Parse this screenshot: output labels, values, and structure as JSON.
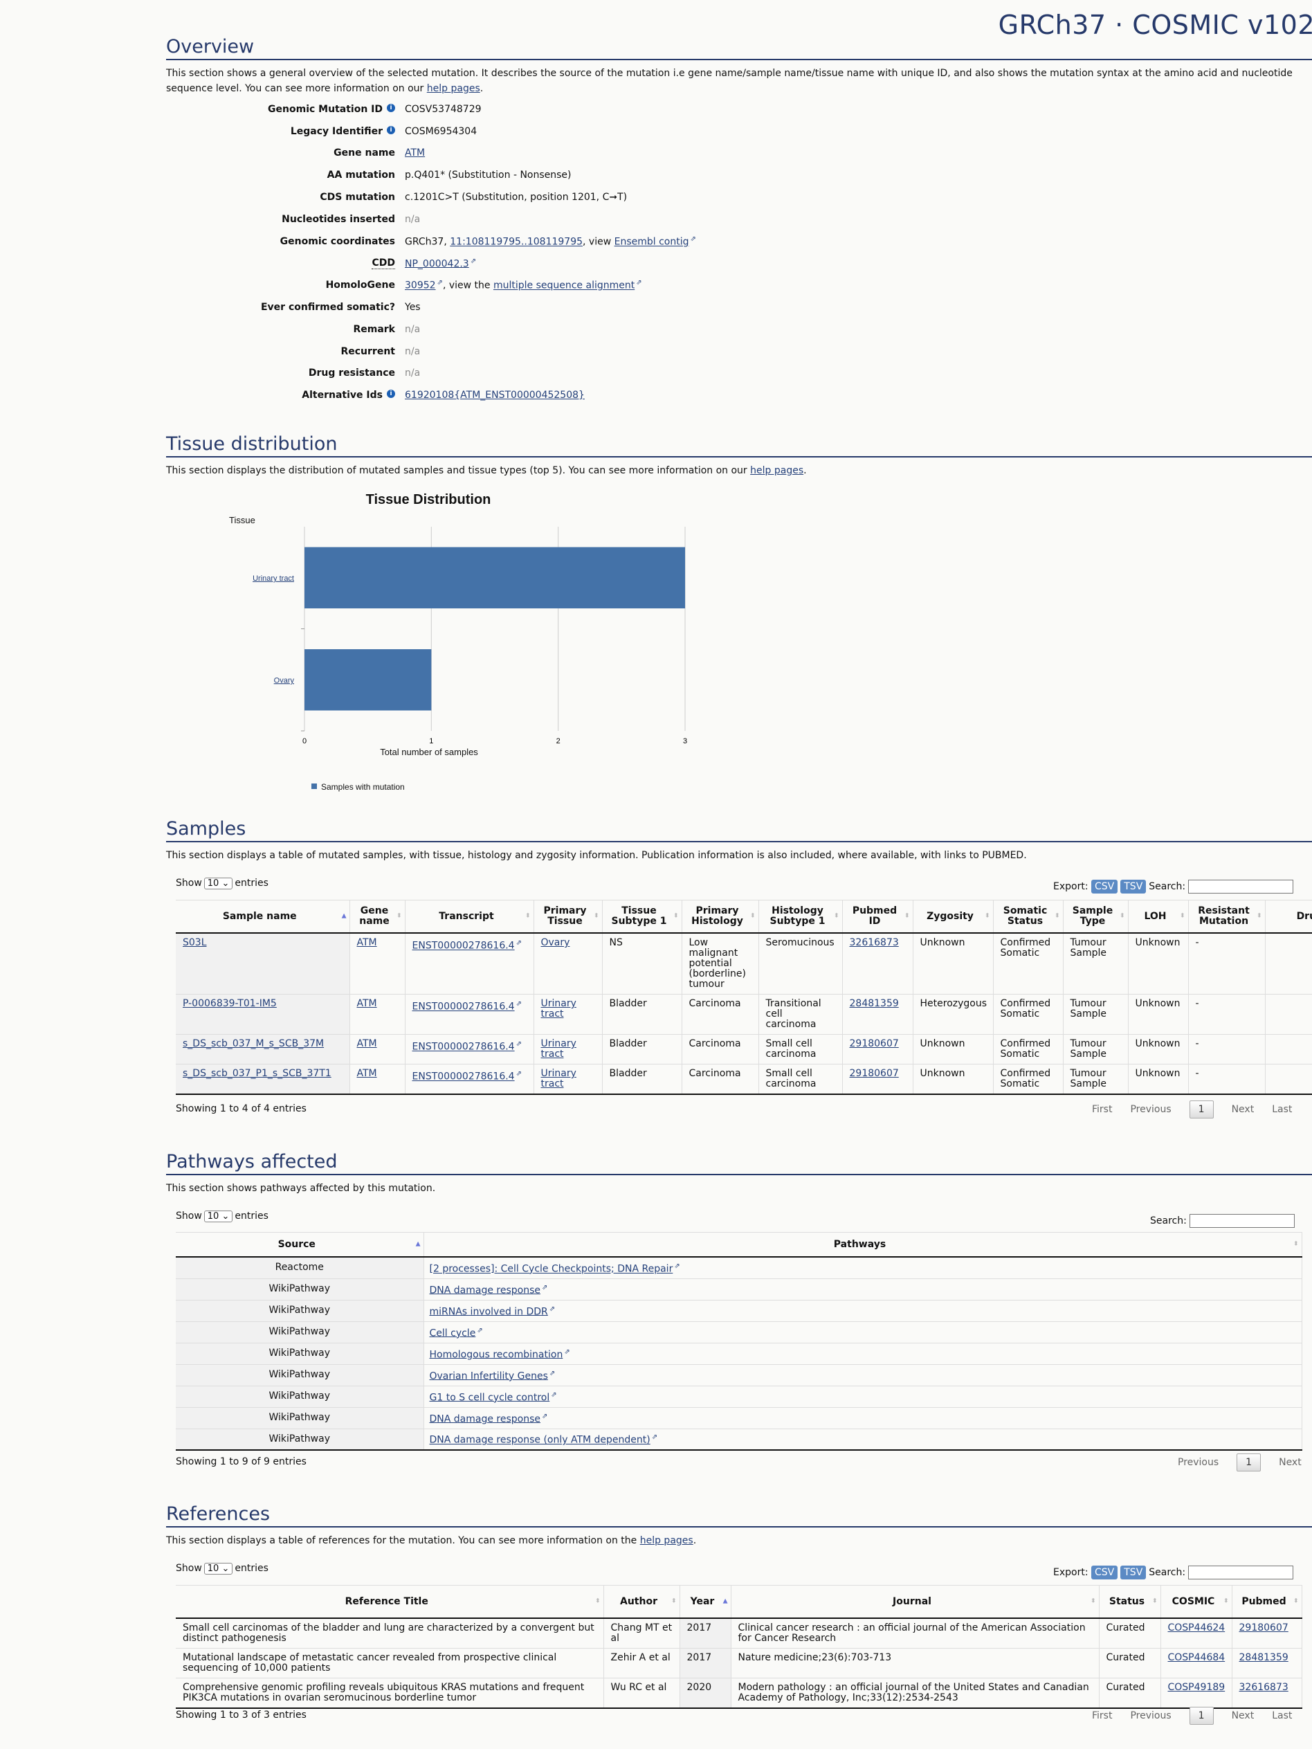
{
  "site_title": "GRCh37 · COSMIC v102",
  "overview": {
    "heading": "Overview",
    "desc_pre": "This section shows a general overview of the selected mutation. It describes the source of the mutation i.e gene name/sample name/tissue name with unique ID, and also shows the mutation syntax at the amino acid and nucleotide sequence level. You can see more information on our ",
    "desc_link": "help pages",
    "desc_post": ".",
    "rows": {
      "gmid": {
        "label": "Genomic Mutation ID",
        "value": "COSV53748729"
      },
      "legacy": {
        "label": "Legacy Identifier",
        "value": "COSM6954304"
      },
      "gene": {
        "label": "Gene name",
        "value": "ATM"
      },
      "aa": {
        "label": "AA mutation",
        "value": "p.Q401* (Substitution - Nonsense)"
      },
      "cds": {
        "label": "CDS mutation",
        "value": "c.1201C>T (Substitution, position 1201, C➞T)"
      },
      "nuc": {
        "label": "Nucleotides inserted",
        "value": "n/a"
      },
      "coords": {
        "label": "Genomic coordinates",
        "pre": "GRCh37, ",
        "link": "11:108119795..108119795",
        "mid": ", view ",
        "link2": "Ensembl contig"
      },
      "cdd": {
        "label": "CDD",
        "link": "NP_000042.3"
      },
      "homolo": {
        "label": "HomoloGene",
        "link": "30952",
        "mid": ", view the ",
        "link2": "multiple sequence alignment"
      },
      "somatic": {
        "label": "Ever confirmed somatic?",
        "value": "Yes"
      },
      "remark": {
        "label": "Remark",
        "value": "n/a"
      },
      "recurrent": {
        "label": "Recurrent",
        "value": "n/a"
      },
      "drug": {
        "label": "Drug resistance",
        "value": "n/a"
      },
      "alt": {
        "label": "Alternative Ids",
        "link": "61920108{ATM_ENST00000452508}"
      }
    }
  },
  "tissue": {
    "heading": "Tissue distribution",
    "desc_pre": "This section displays the distribution of mutated samples and tissue types (top 5). You can see more information on our ",
    "desc_link": "help pages",
    "desc_post": "."
  },
  "chart_data": {
    "type": "bar",
    "orientation": "horizontal",
    "title": "Tissue Distribution",
    "ylabel": "Tissue",
    "xlabel": "Total number of samples",
    "categories": [
      "Urinary tract",
      "Ovary"
    ],
    "series": [
      {
        "name": "Samples with mutation",
        "values": [
          3,
          1
        ]
      }
    ],
    "xlim": [
      0,
      3
    ],
    "xticks": [
      "0",
      "1",
      "2",
      "3"
    ],
    "grid": true,
    "legend": "bottom-left",
    "color": "#4472a8"
  },
  "controls": {
    "show": "Show",
    "entries": "entries",
    "page_size": "10",
    "export": "Export:",
    "csv": "CSV",
    "tsv": "TSV",
    "search": "Search:",
    "first": "First",
    "previous": "Previous",
    "page": "1",
    "next": "Next",
    "last": "Last"
  },
  "samples": {
    "heading": "Samples",
    "desc": "This section displays a table of mutated samples, with tissue, histology and zygosity information. Publication information is also included, where available, with links to PUBMED.",
    "columns": [
      {
        "label": "Sample name",
        "link": true,
        "sorted": true
      },
      {
        "label": "Gene name",
        "link": true
      },
      {
        "label": "Transcript",
        "link": true,
        "ext": true
      },
      {
        "label": "Primary Tissue",
        "link": true
      },
      {
        "label": "Tissue Subtype 1"
      },
      {
        "label": "Primary Histology"
      },
      {
        "label": "Histology Subtype 1"
      },
      {
        "label": "Pubmed ID",
        "link": true
      },
      {
        "label": "Zygosity"
      },
      {
        "label": "Somatic Status"
      },
      {
        "label": "Sample Type"
      },
      {
        "label": "LOH"
      },
      {
        "label": "Resistant Mutation"
      },
      {
        "label": "Drugs"
      }
    ],
    "rows": [
      [
        "S03L",
        "ATM",
        "ENST00000278616.4",
        "Ovary",
        "NS",
        "Low malignant potential (borderline) tumour",
        "Seromucinous",
        "32616873",
        "Unknown",
        "Confirmed Somatic",
        "Tumour Sample",
        "Unknown",
        "-",
        ""
      ],
      [
        "P-0006839-T01-IM5",
        "ATM",
        "ENST00000278616.4",
        "Urinary tract",
        "Bladder",
        "Carcinoma",
        "Transitional cell carcinoma",
        "28481359",
        "Heterozygous",
        "Confirmed Somatic",
        "Tumour Sample",
        "Unknown",
        "-",
        ""
      ],
      [
        "s_DS_scb_037_M_s_SCB_37M",
        "ATM",
        "ENST00000278616.4",
        "Urinary tract",
        "Bladder",
        "Carcinoma",
        "Small cell carcinoma",
        "29180607",
        "Unknown",
        "Confirmed Somatic",
        "Tumour Sample",
        "Unknown",
        "-",
        ""
      ],
      [
        "s_DS_scb_037_P1_s_SCB_37T1",
        "ATM",
        "ENST00000278616.4",
        "Urinary tract",
        "Bladder",
        "Carcinoma",
        "Small cell carcinoma",
        "29180607",
        "Unknown",
        "Confirmed Somatic",
        "Tumour Sample",
        "Unknown",
        "-",
        ""
      ]
    ],
    "info": "Showing 1 to 4 of 4 entries"
  },
  "pathways": {
    "heading": "Pathways affected",
    "desc": "This section shows pathways affected by this mutation.",
    "columns": [
      {
        "label": "Source",
        "sorted": true,
        "center": true
      },
      {
        "label": "Pathways",
        "link": true,
        "ext": true
      }
    ],
    "rows": [
      [
        "Reactome",
        "[2 processes]: Cell Cycle Checkpoints; DNA Repair"
      ],
      [
        "WikiPathway",
        "DNA damage response"
      ],
      [
        "WikiPathway",
        "miRNAs involved in DDR"
      ],
      [
        "WikiPathway",
        "Cell cycle"
      ],
      [
        "WikiPathway",
        "Homologous recombination"
      ],
      [
        "WikiPathway",
        "Ovarian Infertility Genes"
      ],
      [
        "WikiPathway",
        "G1 to S cell cycle control"
      ],
      [
        "WikiPathway",
        "DNA damage response"
      ],
      [
        "WikiPathway",
        "DNA damage response (only ATM dependent)"
      ]
    ],
    "info": "Showing 1 to 9 of 9 entries"
  },
  "references": {
    "heading": "References",
    "desc_pre": "This section displays a table of references for the mutation. You can see more information on the ",
    "desc_link": "help pages",
    "desc_post": ".",
    "columns": [
      {
        "label": "Reference Title"
      },
      {
        "label": "Author"
      },
      {
        "label": "Year",
        "sorted": true
      },
      {
        "label": "Journal"
      },
      {
        "label": "Status"
      },
      {
        "label": "COSMIC",
        "link": true
      },
      {
        "label": "Pubmed",
        "link": true
      }
    ],
    "rows": [
      [
        "Small cell carcinomas of the bladder and lung are characterized by a convergent but distinct pathogenesis",
        "Chang MT et al",
        "2017",
        "Clinical cancer research : an official journal of the American Association for Cancer Research",
        "Curated",
        "COSP44624",
        "29180607"
      ],
      [
        "Mutational landscape of metastatic cancer revealed from prospective clinical sequencing of 10,000 patients",
        "Zehir A et al",
        "2017",
        "Nature medicine;23(6):703-713",
        "Curated",
        "COSP44684",
        "28481359"
      ],
      [
        "Comprehensive genomic profiling reveals ubiquitous KRAS mutations and frequent PIK3CA mutations in ovarian seromucinous borderline tumor",
        "Wu RC et al",
        "2020",
        "Modern pathology : an official journal of the United States and Canadian Academy of Pathology, Inc;33(12):2534-2543",
        "Curated",
        "COSP49189",
        "32616873"
      ]
    ],
    "info": "Showing 1 to 3 of 3 entries"
  }
}
